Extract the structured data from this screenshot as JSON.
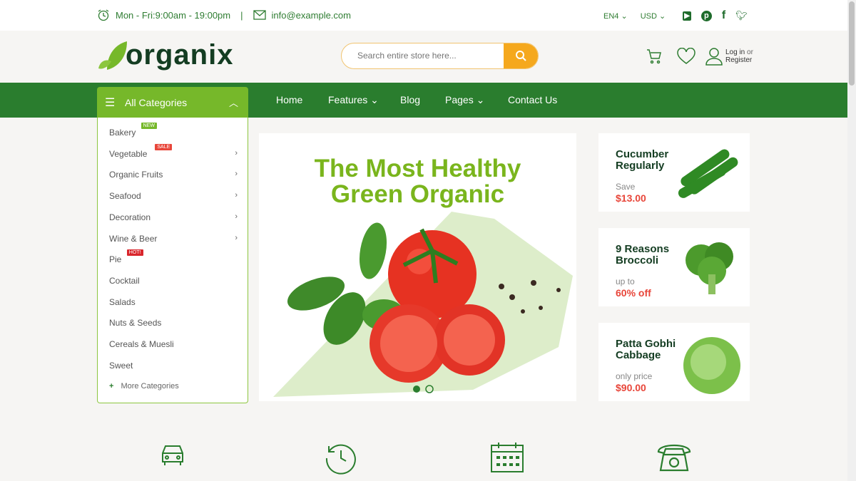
{
  "topbar": {
    "hours": "Mon - Fri:9:00am - 19:00pm",
    "separator": "|",
    "email": "info@example.com",
    "language": "EN4",
    "currency": "USD",
    "socials": [
      "youtube-icon",
      "pinterest-icon",
      "facebook-icon",
      "twitter-icon"
    ]
  },
  "header": {
    "logo": "organix",
    "search_placeholder": "Search entire store here...",
    "login": "Log in",
    "or": "or",
    "register": "Register"
  },
  "nav": {
    "all_categories": "All Categories",
    "items": [
      {
        "label": "Home"
      },
      {
        "label": "Features"
      },
      {
        "label": "Blog"
      },
      {
        "label": "Pages"
      },
      {
        "label": "Contact Us"
      }
    ]
  },
  "categories": [
    {
      "label": "Bakery",
      "badge": "NEW",
      "badge_color": "#76b82a"
    },
    {
      "label": "Vegetable",
      "badge": "SALE",
      "badge_color": "#e8463a",
      "sub": true
    },
    {
      "label": "Organic Fruits",
      "sub": true
    },
    {
      "label": "Seafood",
      "sub": true
    },
    {
      "label": "Decoration",
      "sub": true
    },
    {
      "label": "Wine & Beer",
      "sub": true
    },
    {
      "label": "Pie",
      "badge": "HOT!",
      "badge_color": "#d9262c"
    },
    {
      "label": "Cocktail"
    },
    {
      "label": "Salads"
    },
    {
      "label": "Nuts & Seeds"
    },
    {
      "label": "Cereals & Muesli"
    },
    {
      "label": "Sweet"
    }
  ],
  "more_categories": "More Categories",
  "banner": {
    "line1": "The Most Healthy",
    "line2": "Green Organic",
    "slides": 2,
    "active_slide": 1
  },
  "promos": [
    {
      "title1": "Cucumber",
      "title2": "Regularly",
      "sub": "Save",
      "price": "$13.00"
    },
    {
      "title1": "9 Reasons",
      "title2": "Broccoli",
      "sub": "up to",
      "price": "60% off"
    },
    {
      "title1": "Patta Gobhi",
      "title2": "Cabbage",
      "sub": "only price",
      "price": "$90.00"
    }
  ],
  "features": [
    "car-icon",
    "clock-return-icon",
    "calendar-icon",
    "telephone-icon"
  ],
  "colors": {
    "primary": "#2a7d2e",
    "accent": "#76b82a",
    "headline": "#7ab51d",
    "search_button": "#f5a81d",
    "price": "#e8463a"
  }
}
